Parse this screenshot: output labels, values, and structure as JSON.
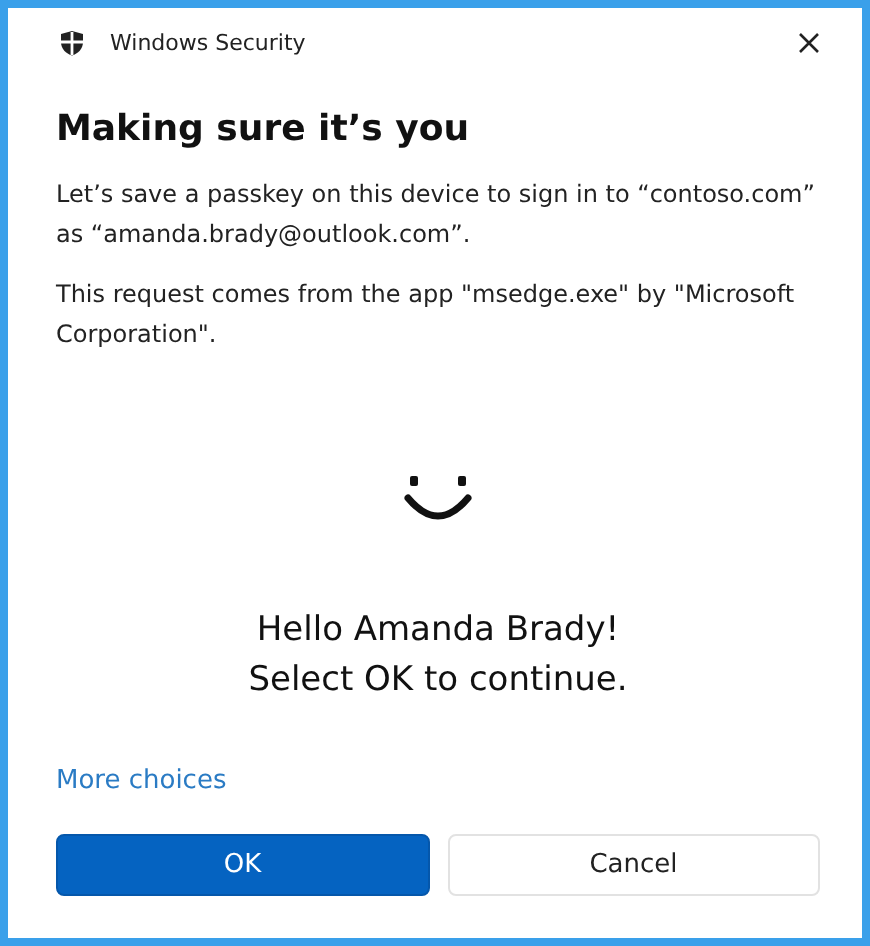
{
  "window": {
    "title": "Windows Security"
  },
  "heading": "Making sure it’s you",
  "paragraphs": [
    "Let’s save a passkey on this device to sign in to “contoso.com” as “amanda.brady@outlook.com”.",
    "This request comes from the app \"msedge.exe\" by \"Microsoft Corporation\"."
  ],
  "greeting": [
    "Hello Amanda Brady!",
    "Select OK to continue."
  ],
  "more_choices": "More choices",
  "buttons": [
    {
      "label": "OK",
      "kind": "primary"
    },
    {
      "label": "Cancel",
      "kind": "secondary"
    }
  ]
}
